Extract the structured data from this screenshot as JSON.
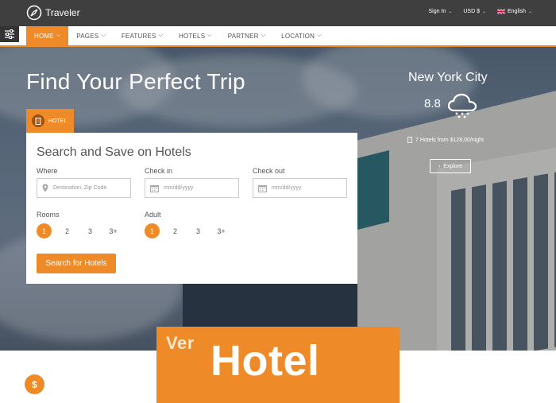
{
  "brand": {
    "name": "Traveler"
  },
  "topbar": {
    "sign_in": "Sign In",
    "currency": "USD $",
    "language": "English"
  },
  "nav": {
    "items": [
      {
        "label": "HOME",
        "active": true
      },
      {
        "label": "PAGES",
        "active": false
      },
      {
        "label": "FEATURES",
        "active": false
      },
      {
        "label": "HOTELS",
        "active": false
      },
      {
        "label": "PARTNER",
        "active": false
      },
      {
        "label": "LOCATION",
        "active": false
      }
    ]
  },
  "hero": {
    "title": "Find Your Perfect Trip",
    "tab_label": "HOTEL"
  },
  "search": {
    "title": "Search and Save on Hotels",
    "where_label": "Where",
    "where_placeholder": "Destination, Zip Code",
    "checkin_label": "Check in",
    "checkin_placeholder": "mm/dd/yyyy",
    "checkout_label": "Check out",
    "checkout_placeholder": "mm/dd/yyyy",
    "rooms_label": "Rooms",
    "rooms_options": [
      "1",
      "2",
      "3",
      "3+"
    ],
    "rooms_selected": "1",
    "adult_label": "Adult",
    "adult_options": [
      "1",
      "2",
      "3",
      "3+"
    ],
    "adult_selected": "1",
    "button_label": "Search for Hotels"
  },
  "destination": {
    "city": "New York City",
    "temperature": "8.8",
    "weather_icon": "snow-cloud-icon",
    "info": "7 Hotels from $128,00/night",
    "explore_label": "Explore"
  },
  "promo": {
    "small": "Ver",
    "big": "Hotel"
  },
  "colors": {
    "accent": "#ee8b28",
    "topbar": "#3f3f3f"
  }
}
